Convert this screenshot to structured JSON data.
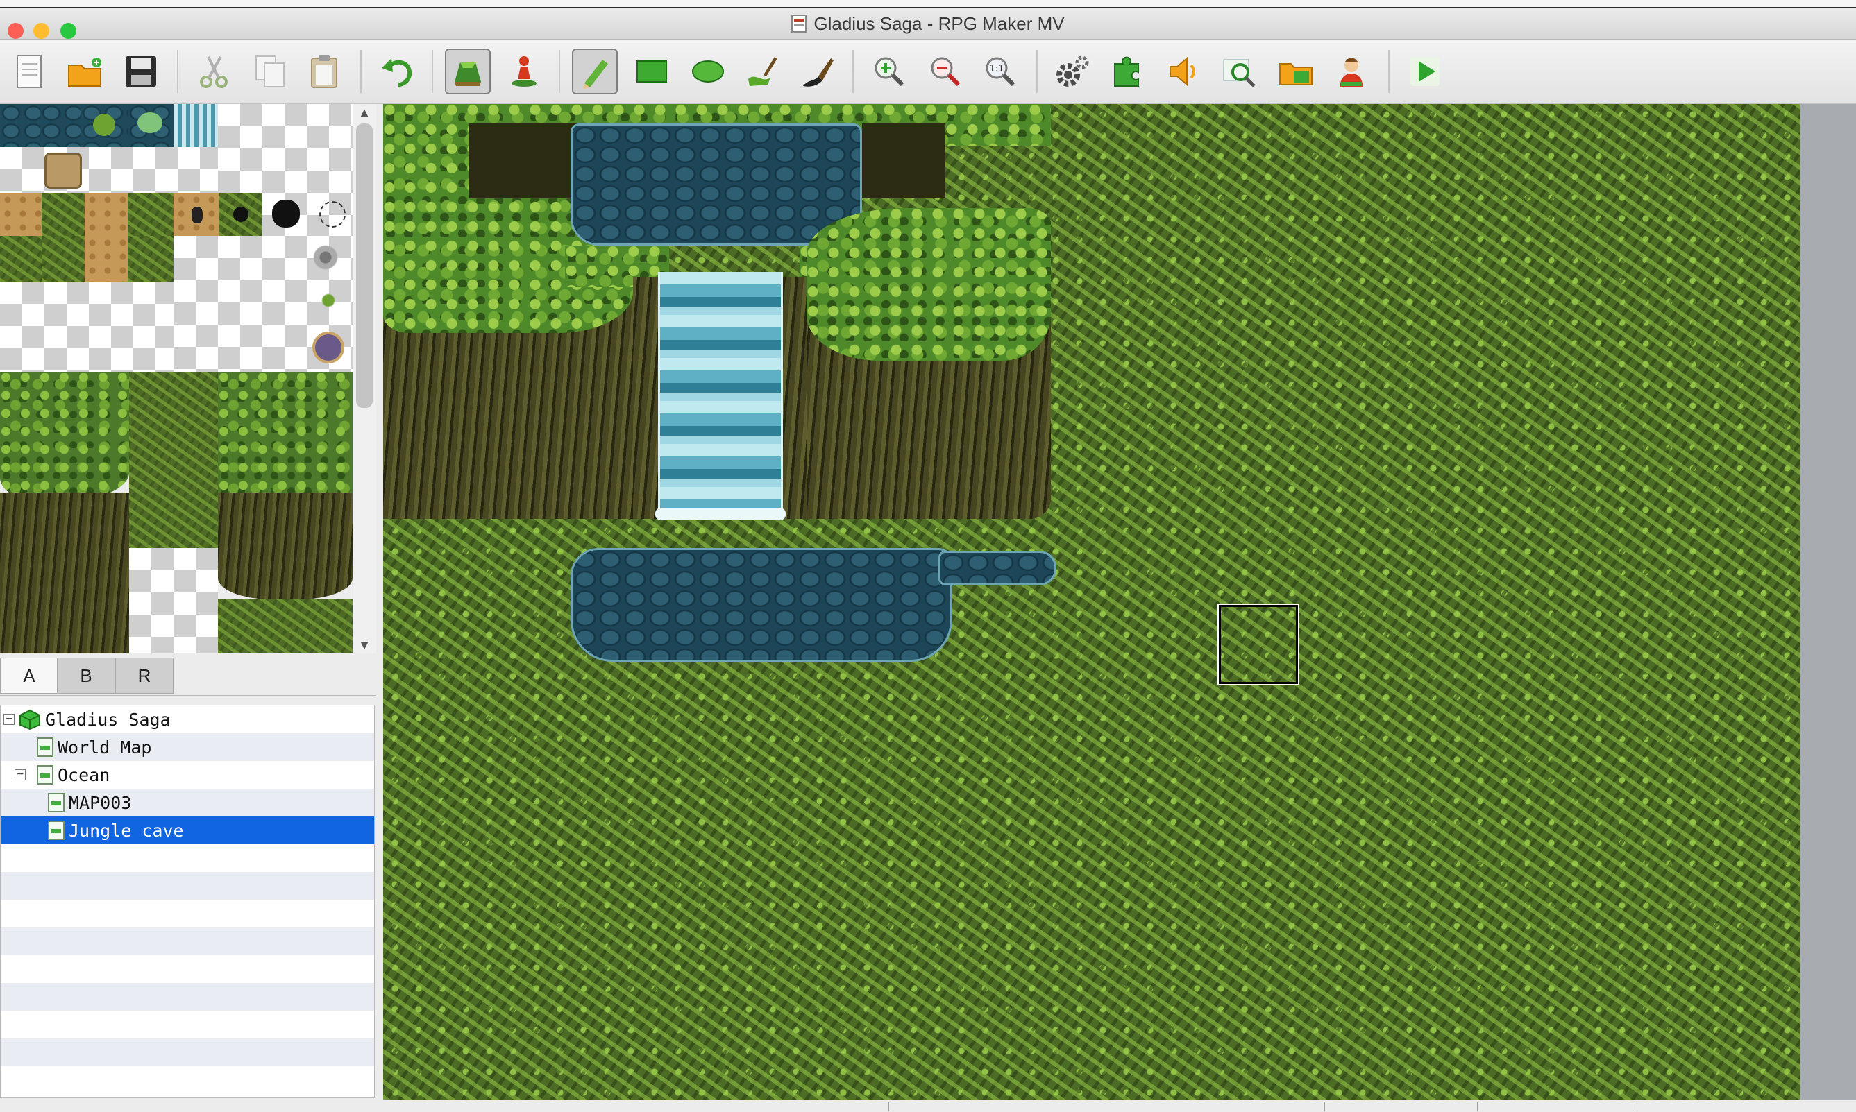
{
  "window": {
    "title": "Gladius Saga - RPG Maker MV",
    "app_icon": "project-document-icon",
    "colors": {
      "close": "#fd5f57",
      "minimize": "#febc2e",
      "zoom": "#28c840"
    }
  },
  "toolbar": {
    "buttons": [
      {
        "id": "new-project",
        "icon": "new-document-icon",
        "pressed": false
      },
      {
        "id": "open-project",
        "icon": "open-folder-icon",
        "pressed": false
      },
      {
        "id": "save-project",
        "icon": "floppy-disk-icon",
        "pressed": false
      },
      {
        "id": "cut",
        "icon": "scissors-icon",
        "pressed": false
      },
      {
        "id": "copy",
        "icon": "copy-icon",
        "pressed": false
      },
      {
        "id": "paste",
        "icon": "clipboard-icon",
        "pressed": false
      },
      {
        "id": "undo",
        "icon": "undo-arrow-icon",
        "pressed": false
      },
      {
        "id": "map-mode",
        "icon": "map-layer-icon",
        "pressed": true
      },
      {
        "id": "event-mode",
        "icon": "event-figure-icon",
        "pressed": false
      },
      {
        "id": "pencil",
        "icon": "pencil-icon",
        "pressed": true
      },
      {
        "id": "rectangle",
        "icon": "rectangle-icon",
        "pressed": false
      },
      {
        "id": "ellipse",
        "icon": "ellipse-icon",
        "pressed": false
      },
      {
        "id": "flood-fill",
        "icon": "fill-brush-icon",
        "pressed": false
      },
      {
        "id": "shadow-pen",
        "icon": "shadow-pen-icon",
        "pressed": false
      },
      {
        "id": "zoom-in",
        "icon": "zoom-in-icon",
        "pressed": false
      },
      {
        "id": "zoom-out",
        "icon": "zoom-out-icon",
        "pressed": false
      },
      {
        "id": "actual-size",
        "icon": "zoom-actual-icon",
        "label": "1:1",
        "pressed": false
      },
      {
        "id": "database",
        "icon": "gear-icon",
        "pressed": false
      },
      {
        "id": "plugin-manager",
        "icon": "puzzle-icon",
        "pressed": false
      },
      {
        "id": "sound-test",
        "icon": "speaker-icon",
        "pressed": false
      },
      {
        "id": "event-searcher",
        "icon": "search-window-icon",
        "pressed": false
      },
      {
        "id": "resource-manager",
        "icon": "resource-folder-icon",
        "pressed": false
      },
      {
        "id": "character-generator",
        "icon": "character-icon",
        "pressed": false
      },
      {
        "id": "playtest",
        "icon": "play-icon",
        "pressed": false
      }
    ]
  },
  "tileset_tabs": [
    "A",
    "B",
    "R"
  ],
  "active_tab": "A",
  "map_tree": {
    "items": [
      {
        "label": "Gladius Saga",
        "level": 0,
        "expanded": true,
        "type": "project",
        "selected": false
      },
      {
        "label": "World Map",
        "level": 1,
        "type": "map",
        "selected": false
      },
      {
        "label": "Ocean",
        "level": 1,
        "expanded": true,
        "type": "map",
        "selected": false
      },
      {
        "label": "MAP003",
        "level": 2,
        "type": "map",
        "selected": false
      },
      {
        "label": "Jungle cave",
        "level": 2,
        "type": "map",
        "selected": true
      }
    ]
  }
}
